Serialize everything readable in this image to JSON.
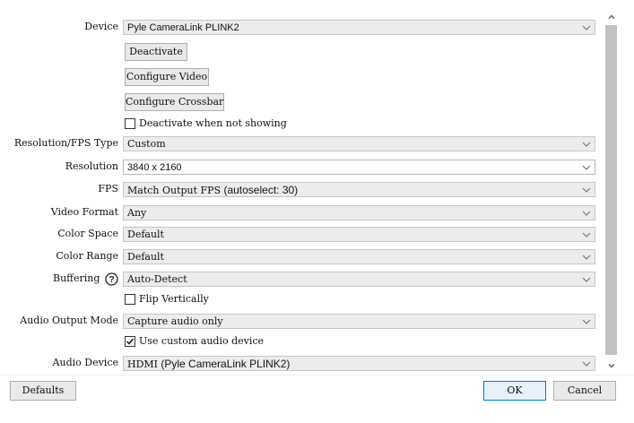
{
  "device": {
    "label": "Device",
    "value": "Pyle CameraLink PLINK2"
  },
  "buttons": {
    "deactivate": "Deactivate",
    "configure_video": "Configure Video",
    "configure_crossbar": "Configure Crossbar",
    "defaults": "Defaults",
    "ok": "OK",
    "cancel": "Cancel"
  },
  "checkboxes": {
    "deactivate_when_not_showing": {
      "label": "Deactivate when not showing",
      "checked": false
    },
    "flip_vertically": {
      "label": "Flip Vertically",
      "checked": false
    },
    "use_custom_audio_device": {
      "label": "Use custom audio device",
      "checked": true
    }
  },
  "fields": {
    "res_fps_type": {
      "label": "Resolution/FPS Type",
      "value": "Custom"
    },
    "resolution": {
      "label": "Resolution",
      "value": "3840 x 2160"
    },
    "fps": {
      "label": "FPS",
      "value": "Match Output FPS",
      "value_suffix": " (autoselect: 30)"
    },
    "video_format": {
      "label": "Video Format",
      "value": "Any"
    },
    "color_space": {
      "label": "Color Space",
      "value": "Default"
    },
    "color_range": {
      "label": "Color Range",
      "value": "Default"
    },
    "buffering": {
      "label": "Buffering",
      "value": "Auto-Detect",
      "help_icon": "question-circle-icon"
    },
    "audio_output_mode": {
      "label": "Audio Output Mode",
      "value": "Capture audio only"
    },
    "audio_device": {
      "label": "Audio Device",
      "value": "HDMI",
      "value_suffix": " (Pyle CameraLink PLINK2)"
    }
  },
  "icons": {
    "dropdown": "chevron-down-icon",
    "scroll_up": "scroll-up-arrow-icon",
    "scroll_down": "scroll-down-arrow-icon"
  },
  "colors": {
    "ok_border": "#0078d7",
    "field_bg": "#ececec",
    "scroll_thumb": "#c1c1c1"
  }
}
